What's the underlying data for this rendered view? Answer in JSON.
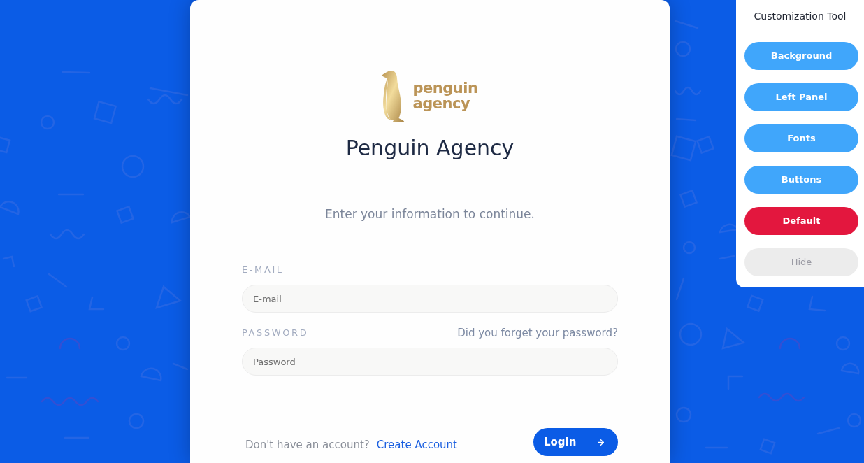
{
  "logo": {
    "lines": [
      "penguin",
      "agency"
    ]
  },
  "title": "Penguin Agency",
  "subtitle": "Enter your information to continue.",
  "form": {
    "fields": [
      {
        "label": "E-MAIL",
        "placeholder": "E-mail"
      },
      {
        "label": "PASSWORD",
        "placeholder": "Password",
        "link": "Did you forget your password?"
      }
    ]
  },
  "footer": {
    "prompt": "Don't have an account?",
    "link": "Create Account",
    "button": "Login"
  },
  "customization_panel": {
    "title": "Customization Tool",
    "buttons": [
      {
        "kind": "option",
        "label": "Background"
      },
      {
        "kind": "option",
        "label": "Left Panel"
      },
      {
        "kind": "option",
        "label": "Fonts"
      },
      {
        "kind": "option",
        "label": "Buttons"
      },
      {
        "kind": "reset",
        "label": "Default"
      },
      {
        "kind": "hide",
        "label": "Hide"
      }
    ]
  }
}
